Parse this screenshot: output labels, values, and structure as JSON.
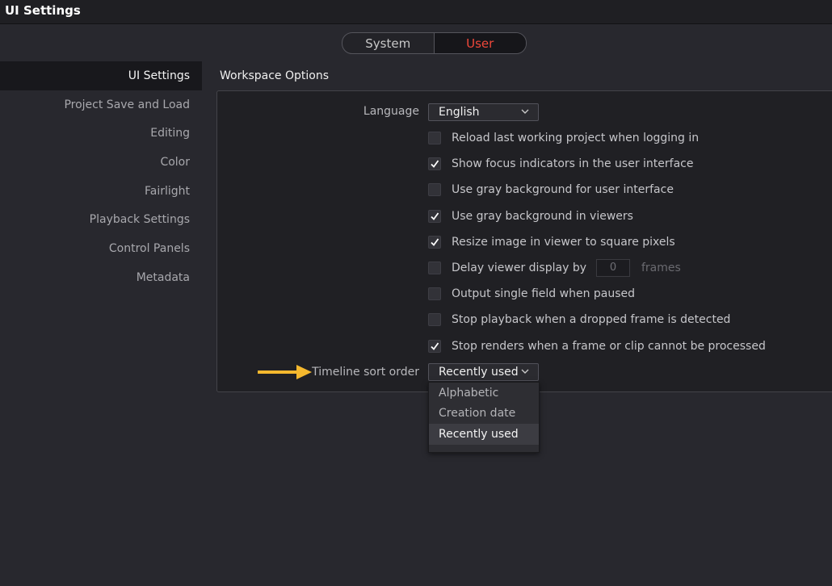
{
  "window": {
    "title": "UI Settings"
  },
  "scope_toggle": {
    "system_label": "System",
    "user_label": "User",
    "active": "User"
  },
  "sidebar": {
    "items": [
      {
        "label": "UI Settings",
        "active": true
      },
      {
        "label": "Project Save and Load"
      },
      {
        "label": "Editing"
      },
      {
        "label": "Color"
      },
      {
        "label": "Fairlight"
      },
      {
        "label": "Playback Settings"
      },
      {
        "label": "Control Panels"
      },
      {
        "label": "Metadata"
      }
    ]
  },
  "workspace": {
    "title": "Workspace Options",
    "language": {
      "label": "Language",
      "value": "English"
    },
    "checkboxes": [
      {
        "label": "Reload last working project when logging in",
        "checked": false
      },
      {
        "label": "Show focus indicators in the user interface",
        "checked": true
      },
      {
        "label": "Use gray background for user interface",
        "checked": false
      },
      {
        "label": "Use gray background in viewers",
        "checked": true
      },
      {
        "label": "Resize image in viewer to square pixels",
        "checked": true
      },
      {
        "label": "Delay viewer display by",
        "checked": false
      },
      {
        "label": "Output single field when paused",
        "checked": false
      },
      {
        "label": "Stop playback when a dropped frame is detected",
        "checked": false
      },
      {
        "label": "Stop renders when a frame or clip cannot be processed",
        "checked": true
      }
    ],
    "delay": {
      "value": "0",
      "unit": "frames"
    },
    "sort_order": {
      "label": "Timeline sort order",
      "value": "Recently used",
      "options": [
        "Alphabetic",
        "Creation date",
        "Recently used"
      ]
    }
  },
  "colors": {
    "accent_red": "#f0483a",
    "arrow": "#f5b82e"
  }
}
